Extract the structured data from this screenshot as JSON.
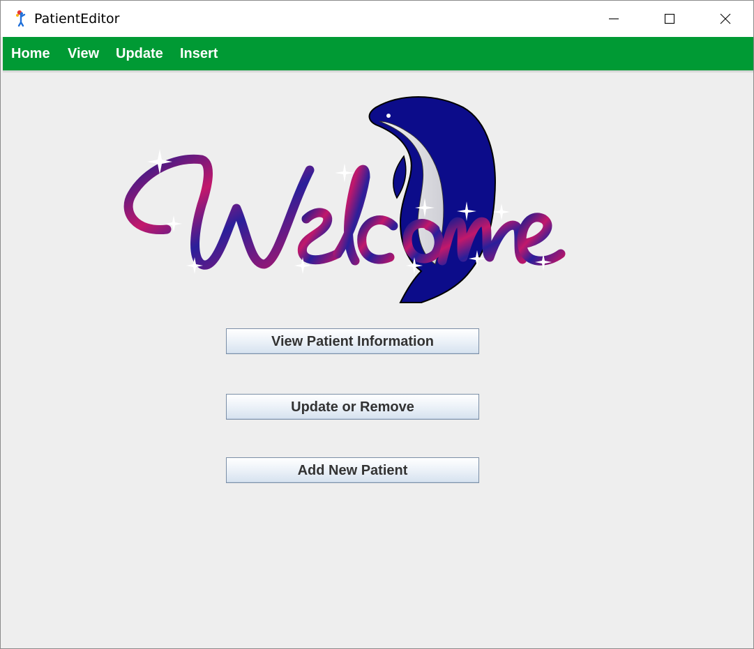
{
  "window": {
    "title": "PatientEditor",
    "icons": {
      "app": "app-figure-icon",
      "minimize": "minimize-icon",
      "maximize": "maximize-icon",
      "close": "close-icon"
    }
  },
  "menubar": {
    "color": "#009a34",
    "items": [
      {
        "label": "Home"
      },
      {
        "label": "View"
      },
      {
        "label": "Update"
      },
      {
        "label": "Insert"
      }
    ]
  },
  "main": {
    "logo": {
      "text": "Welcome",
      "icon": "dolphin-icon"
    },
    "buttons": {
      "view": "View Patient Information",
      "update": "Update or Remove",
      "add": "Add New Patient"
    }
  }
}
